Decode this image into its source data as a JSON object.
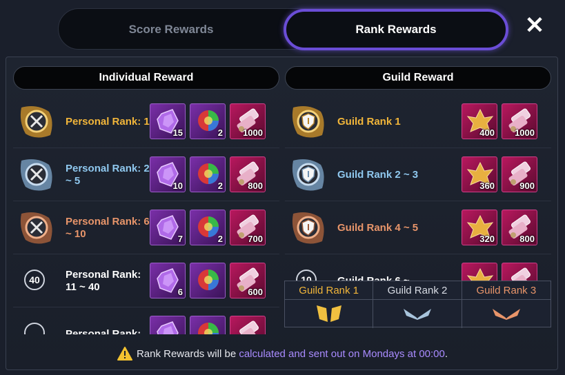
{
  "tabs": [
    {
      "label": "Score Rewards",
      "active": false
    },
    {
      "label": "Rank Rewards",
      "active": true
    }
  ],
  "close_icon": "close-x-icon",
  "individual": {
    "header": "Individual Reward",
    "rows": [
      {
        "label": "Personal Rank: 1",
        "tier": "gold",
        "emblem": "gold-swords-emblem-icon",
        "rewards": [
          {
            "icon": "purple-crystal-icon",
            "qty": "15"
          },
          {
            "icon": "rainbow-orb-icon",
            "qty": "2"
          },
          {
            "icon": "scroll-icon",
            "qty": "1000"
          }
        ]
      },
      {
        "label": "Personal Rank: 2 ~ 5",
        "tier": "blue",
        "emblem": "silver-swords-emblem-icon",
        "rewards": [
          {
            "icon": "purple-crystal-icon",
            "qty": "10"
          },
          {
            "icon": "rainbow-orb-icon",
            "qty": "2"
          },
          {
            "icon": "scroll-icon",
            "qty": "800"
          }
        ]
      },
      {
        "label": "Personal Rank: 6 ~ 10",
        "tier": "bronze",
        "emblem": "bronze-swords-emblem-icon",
        "rewards": [
          {
            "icon": "purple-crystal-icon",
            "qty": "7"
          },
          {
            "icon": "rainbow-orb-icon",
            "qty": "2"
          },
          {
            "icon": "scroll-icon",
            "qty": "700"
          }
        ]
      },
      {
        "label": "Personal Rank: 11 ~ 40",
        "tier": "white",
        "rank_badge": "40",
        "rewards": [
          {
            "icon": "purple-crystal-icon",
            "qty": "6"
          },
          {
            "icon": "rainbow-orb-icon",
            "qty": ""
          },
          {
            "icon": "scroll-icon",
            "qty": "600"
          }
        ]
      },
      {
        "label": "Personal Rank:",
        "tier": "white",
        "rank_badge": "",
        "rewards": [
          {
            "icon": "purple-crystal-icon",
            "qty": ""
          },
          {
            "icon": "rainbow-orb-icon",
            "qty": ""
          },
          {
            "icon": "scroll-icon",
            "qty": ""
          }
        ]
      }
    ]
  },
  "guild": {
    "header": "Guild Reward",
    "rows": [
      {
        "label": "Guild Rank 1",
        "tier": "gold",
        "emblem": "gold-shield-emblem-icon",
        "rewards": [
          {
            "icon": "gold-leaf-icon",
            "qty": "400"
          },
          {
            "icon": "scroll-icon",
            "qty": "1000"
          }
        ]
      },
      {
        "label": "Guild Rank 2 ~ 3",
        "tier": "blue",
        "emblem": "silver-shield-emblem-icon",
        "rewards": [
          {
            "icon": "gold-leaf-icon",
            "qty": "360"
          },
          {
            "icon": "scroll-icon",
            "qty": "900"
          }
        ]
      },
      {
        "label": "Guild Rank 4 ~ 5",
        "tier": "bronze",
        "emblem": "bronze-shield-emblem-icon",
        "rewards": [
          {
            "icon": "gold-leaf-icon",
            "qty": "320"
          },
          {
            "icon": "scroll-icon",
            "qty": "800"
          }
        ]
      },
      {
        "label": "Guild Rank 6 ~",
        "tier": "white",
        "rank_badge": "10",
        "rewards": [
          {
            "icon": "gold-leaf-icon",
            "qty": ""
          },
          {
            "icon": "scroll-icon",
            "qty": ""
          }
        ]
      }
    ]
  },
  "guild_rank_table": {
    "headers": [
      "Guild Rank 1",
      "Guild Rank 2",
      "Guild Rank 3"
    ],
    "header_colors": [
      "#f2b63a",
      "#d8dce4",
      "#e8956a"
    ],
    "icons": [
      "gold-wings-icon",
      "silver-wings-icon",
      "bronze-wings-icon"
    ]
  },
  "notice": {
    "prefix": "Rank Rewards will be ",
    "highlight": "calculated and sent out on Mondays at 00:00",
    "suffix": ".",
    "icon": "warning-icon"
  },
  "colors": {
    "gold": "#f2b63a",
    "blue": "#8fc8ef",
    "bronze": "#e8956a",
    "accent": "#6a4dd6"
  }
}
